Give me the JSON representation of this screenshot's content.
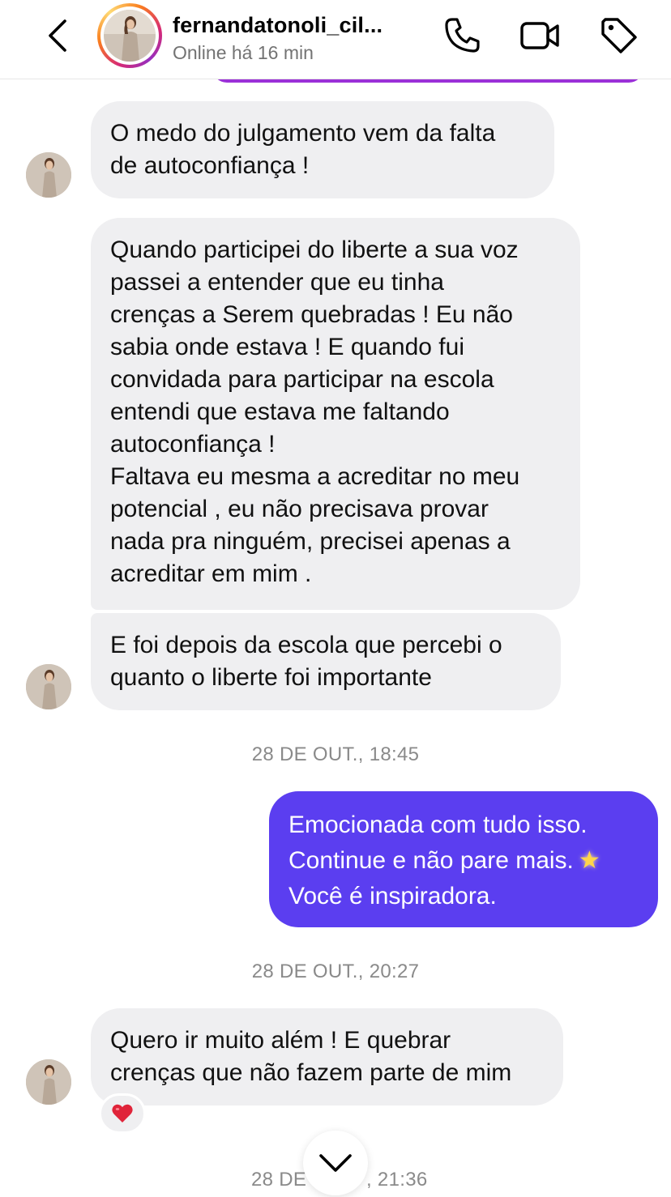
{
  "header": {
    "username": "fernandatonoli_cil...",
    "status": "Online há 16 min",
    "icons": [
      "chevron-left-icon",
      "phone-icon",
      "video-camera-icon",
      "tag-icon"
    ]
  },
  "messages": {
    "m1": {
      "lines": [
        "O medo do julgamento vem da falta",
        "de autoconfiança !"
      ]
    },
    "m2": {
      "lines": [
        "Quando participei do liberte a sua voz",
        "passei a entender que eu tinha",
        "crenças a Serem quebradas ! Eu não",
        "sabia onde estava ! E quando fui",
        "convidada para participar na escola",
        "entendi que estava me faltando",
        "autoconfiança !",
        "Faltava eu mesma a acreditar no meu",
        "potencial , eu não precisava provar",
        "nada pra ninguém, precisei apenas a",
        "acreditar em mim ."
      ]
    },
    "m3": {
      "lines": [
        "E foi depois da escola que percebi o",
        "quanto o liberte foi importante"
      ]
    },
    "ts1": "28 DE OUT., 18:45",
    "m4": {
      "lines": [
        "Emocionada com tudo isso.",
        "Continue e não pare mais.",
        "Você é inspiradora."
      ],
      "emoji": "star-emoji"
    },
    "ts2": "28 DE OUT., 20:27",
    "m5": {
      "lines": [
        "Quero ir muito além ! E quebrar",
        "crenças que não fazem parte de mim"
      ],
      "reaction": "red-heart"
    },
    "ts3_left": "28 DE",
    "ts3_right": ", 21:36"
  },
  "colors": {
    "outgoing_bubble": "#5b3ef0",
    "incoming_bubble": "#efeff1",
    "timestamp": "#8a8a8a",
    "status": "#737373"
  }
}
